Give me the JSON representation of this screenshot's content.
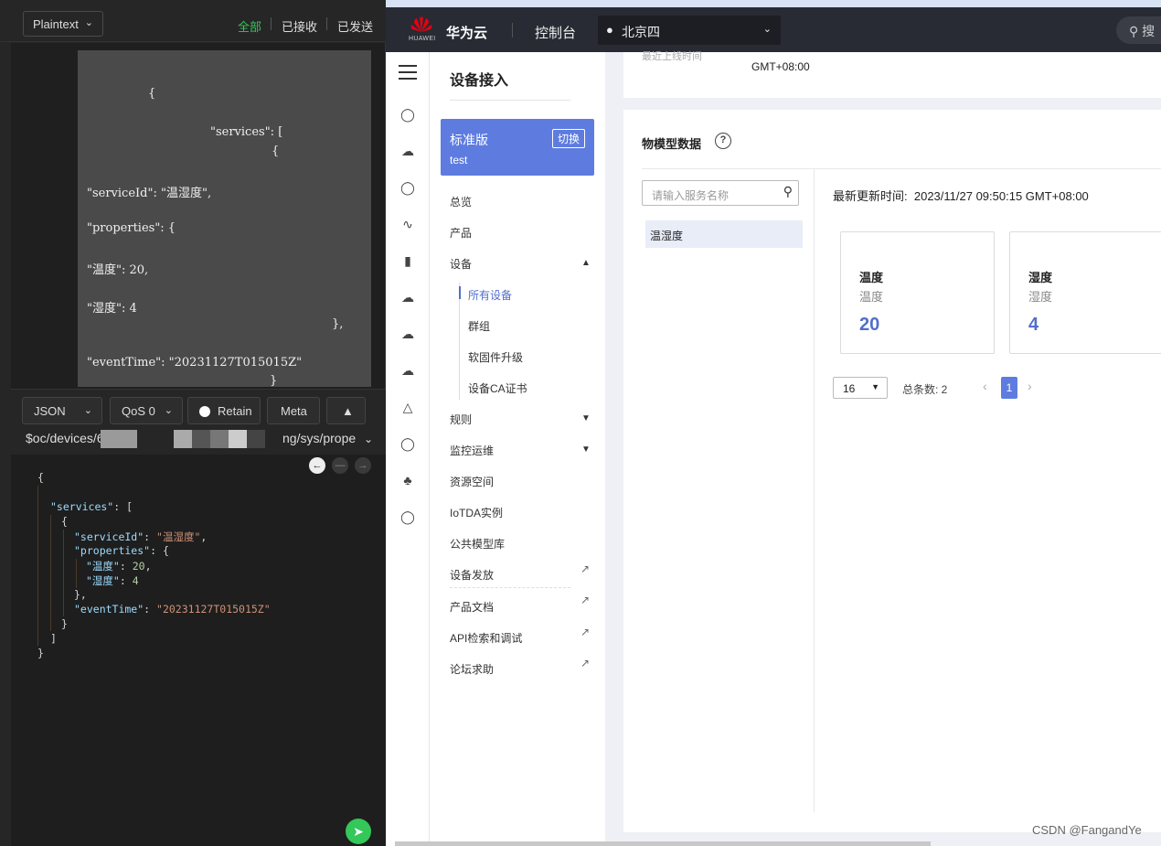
{
  "left": {
    "format": "Plaintext",
    "filters": {
      "all": "全部",
      "received": "已接收",
      "sent": "已发送"
    },
    "message_lines": [
      "{",
      "\"services\": [",
      "{",
      "\"serviceId\": \"温湿度\",",
      "\"properties\": {",
      "\"温度\": 20,",
      "\"湿度\": 4",
      "},",
      "\"eventTime\": \"20231127T015015Z\"",
      "}"
    ],
    "payload_type": "JSON",
    "qos": "QoS 0",
    "retain": "Retain",
    "meta": "Meta",
    "topic_prefix": "$oc/devices/6",
    "topic_suffix": "ng/sys/prope",
    "code": {
      "open_brace": "{",
      "services_key": "\"services\"",
      "services_rest": ": [",
      "obj_open": "{",
      "sid_key": "\"serviceId\"",
      "sid_val": "\"温湿度\"",
      "props_key": "\"properties\"",
      "props_rest": ": {",
      "temp_key": "\"温度\"",
      "temp_val": "20",
      "hum_key": "\"湿度\"",
      "hum_val": "4",
      "props_close": "},",
      "time_key": "\"eventTime\"",
      "time_val": "\"20231127T015015Z\"",
      "obj_close": "}",
      "arr_close": "]",
      "close_brace": "}"
    }
  },
  "right": {
    "logo_sub": "HUAWEI",
    "brand": "华为云",
    "console": "控制台",
    "region": "北京四",
    "search_hint": "搜",
    "nav": {
      "title": "设备接入",
      "edition": "标准版",
      "switch": "切换",
      "instance": "test",
      "items": {
        "overview": "总览",
        "product": "产品",
        "device": "设备",
        "all_devices": "所有设备",
        "group": "群组",
        "ota": "软固件升级",
        "ca": "设备CA证书",
        "rules": "规则",
        "monitor": "监控运维",
        "resource": "资源空间",
        "iotda": "IoTDA实例",
        "model_lib": "公共模型库",
        "provision": "设备发放",
        "docs": "产品文档",
        "api": "API检索和调试",
        "forum": "论坛求助"
      }
    },
    "top_card": {
      "faded_label": "最近上线时间",
      "timezone": "GMT+08:00"
    },
    "model": {
      "title": "物模型数据",
      "search_placeholder": "请输入服务名称",
      "service": "温湿度",
      "updated_label": "最新更新时间:",
      "updated_value": "2023/11/27 09:50:15 GMT+08:00",
      "props": [
        {
          "name": "温度",
          "desc": "温度",
          "value": "20"
        },
        {
          "name": "湿度",
          "desc": "湿度",
          "value": "4"
        }
      ],
      "page_size": "16",
      "total": "总条数: 2",
      "page": "1"
    }
  },
  "watermark": "CSDN @FangandYe"
}
